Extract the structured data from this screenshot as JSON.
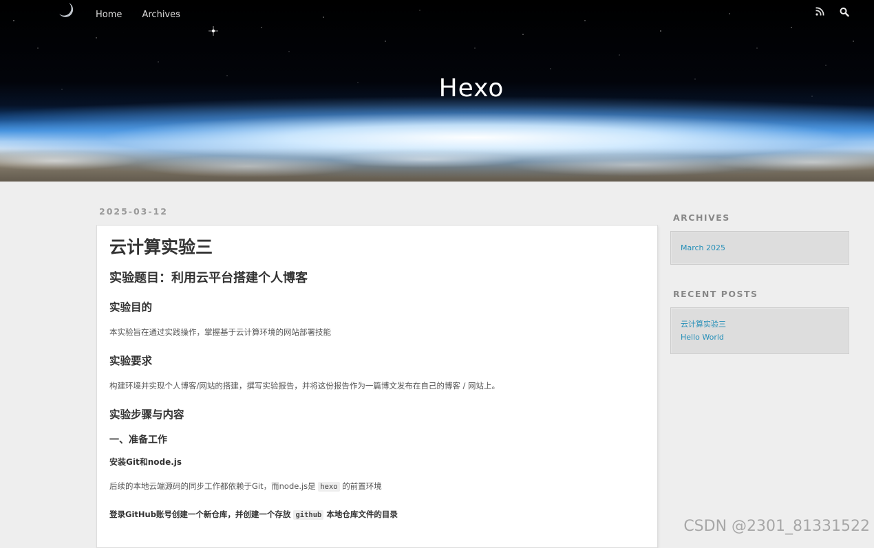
{
  "header": {
    "site_title": "Hexo",
    "nav": [
      {
        "label": "Home"
      },
      {
        "label": "Archives"
      }
    ]
  },
  "post": {
    "date": "2025-03-12",
    "title": "云计算实验三",
    "content": {
      "topic": "实验题目：利用云平台搭建个人博客",
      "purpose_heading": "实验目的",
      "purpose_text": "本实验旨在通过实践操作，掌握基于云计算环境的网站部署技能",
      "requirement_heading": "实验要求",
      "requirement_text": "构建环境并实现个人博客/网站的搭建，撰写实验报告，并将这份报告作为一篇博文发布在自己的博客 / 网站上。",
      "steps_heading": "实验步骤与内容",
      "prep_heading": "一、准备工作",
      "install_heading": "安装Git和node.js",
      "install_text_a": "后续的本地云端源码的同步工作都依赖于Git，而node.js是",
      "install_code": "hexo",
      "install_text_b": "的前置环境",
      "login_text_a": "登录GitHub账号创建一个新仓库，并创建一个存放",
      "login_code": "github",
      "login_text_b": "本地仓库文件的目录"
    }
  },
  "sidebar": {
    "archives_title": "ARCHIVES",
    "archives": [
      {
        "label": "March 2025"
      }
    ],
    "recent_title": "RECENT POSTS",
    "recent": [
      {
        "label": "云计算实验三"
      },
      {
        "label": "Hello World"
      }
    ]
  },
  "watermark": "CSDN @2301_81331522",
  "colors": {
    "link": "#258fb8",
    "background": "#eeeeee",
    "widget_bg": "#dddddd"
  },
  "icons": [
    "moon-icon",
    "rss-icon",
    "search-icon"
  ]
}
